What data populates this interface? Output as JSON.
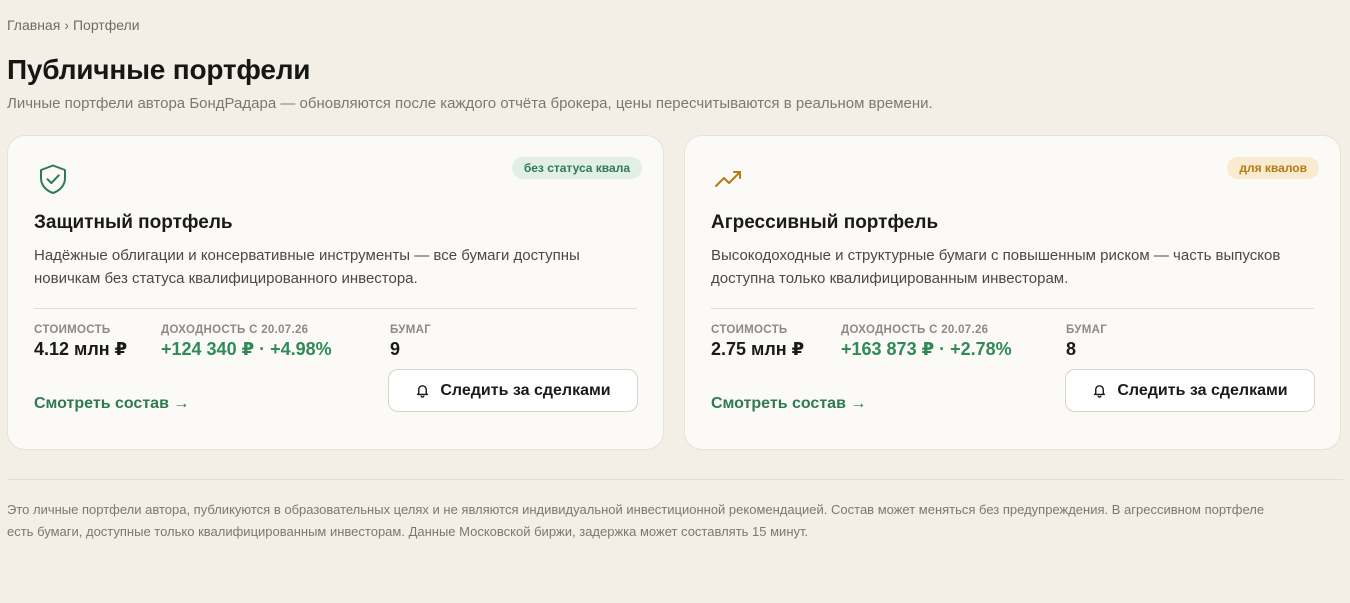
{
  "breadcrumb": {
    "home": "Главная",
    "separator": "›",
    "current": "Портфели"
  },
  "page": {
    "title": "Публичные портфели",
    "subtitle": "Личные портфели автора БондРадара — обновляются после каждого отчёта брокера, цены пересчитываются в реальном времени."
  },
  "cards": [
    {
      "icon": "shield-check-icon",
      "badge": "без статуса квала",
      "badge_color": "#2f7a52",
      "title": "Защитный портфель",
      "description": "Надёжные облигации и консервативные инструменты — все бумаги доступны новичкам без статуса квалифицированного инвестора.",
      "stats": {
        "value_label": "Стоимость",
        "value": "4.12 млн ₽",
        "yield_label": "Доходность с 20.07.26",
        "yield": "+124 340 ₽ · +4.98%",
        "count_label": "Бумаг",
        "count": "9"
      },
      "view_link": "Смотреть состав →",
      "follow_button": "Следить за сделками"
    },
    {
      "icon": "trend-up-icon",
      "badge": "для квалов",
      "badge_color": "#b37a16",
      "title": "Агрессивный портфель",
      "description": "Высокодоходные и структурные бумаги с повышенным риском — часть выпусков доступна только квалифицированным инвесторам.",
      "stats": {
        "value_label": "Стоимость",
        "value": "2.75 млн ₽",
        "yield_label": "Доходность с 20.07.26",
        "yield": "+163 873 ₽ · +2.78%",
        "count_label": "Бумаг",
        "count": "8"
      },
      "view_link": "Смотреть состав →",
      "follow_button": "Следить за сделками"
    }
  ],
  "footer": {
    "disclaimer": "Это личные портфели автора, публикуются в образовательных целях и не являются индивидуальной инвестиционной рекомендацией. Состав может меняться без предупреждения. В агрессивном портфеле есть бумаги, доступные только квалифицированным инвесторам. Данные Московской биржи, задержка может составлять 15 минут."
  },
  "colors": {
    "background": "#f3efe6",
    "card": "#fbfaf7",
    "accent_green": "#2f7a52",
    "gain_green": "#2f8a58",
    "accent_amber": "#b37a16"
  }
}
